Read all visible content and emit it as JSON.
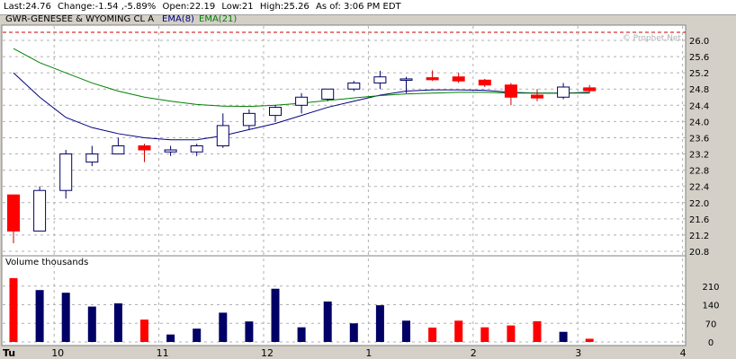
{
  "quote_bar": {
    "last": "Last:24.76",
    "change": "Change:-1.54 ,-5.89%",
    "open": "Open:22.19",
    "low": "Low:21",
    "high": "High:25.26",
    "as_of": "As of: 3:06 PM EDT"
  },
  "legend": {
    "symbol": "GWR-GENESEE & WYOMING CL A",
    "ema8": "EMA(8)",
    "ema21": "EMA(21)"
  },
  "watermark": "© Prophet.Net",
  "volume_label": "Volume  thousands",
  "colors": {
    "up_fill": "#ffffff",
    "down_fill": "#ff0000",
    "candle_outline": "#000066",
    "ema8": "#000080",
    "ema21": "#008000",
    "vol_up": "#000066",
    "vol_down": "#ff0000",
    "grid": "#b0b0b0",
    "high_line": "#cc0000"
  },
  "x_labels": [
    {
      "slot": 0,
      "text": "Tu",
      "bold": true
    },
    {
      "slot": 2,
      "text": "10"
    },
    {
      "slot": 6,
      "text": "11"
    },
    {
      "slot": 10,
      "text": "12"
    },
    {
      "slot": 14,
      "text": "1"
    },
    {
      "slot": 18,
      "text": "2"
    },
    {
      "slot": 22,
      "text": "3"
    },
    {
      "slot": 26,
      "text": "4"
    }
  ],
  "chart_data": [
    {
      "type": "candlestick",
      "title": "GWR-GENESEE & WYOMING CL A",
      "interval": "15-minute",
      "ylim": [
        20.8,
        26.0
      ],
      "yticks": [
        20.8,
        21.2,
        21.6,
        22.0,
        22.4,
        22.8,
        23.2,
        23.6,
        24.0,
        24.4,
        24.8,
        25.2,
        25.6,
        26.0
      ],
      "high_reference": 26.2,
      "candles": [
        {
          "o": 22.19,
          "h": 22.2,
          "l": 21.0,
          "c": 21.3
        },
        {
          "o": 21.3,
          "h": 22.4,
          "l": 21.3,
          "c": 22.3
        },
        {
          "o": 22.3,
          "h": 23.3,
          "l": 22.1,
          "c": 23.2
        },
        {
          "o": 23.0,
          "h": 23.4,
          "l": 22.9,
          "c": 23.2
        },
        {
          "o": 23.2,
          "h": 23.6,
          "l": 23.2,
          "c": 23.4
        },
        {
          "o": 23.4,
          "h": 23.45,
          "l": 23.0,
          "c": 23.3
        },
        {
          "o": 23.25,
          "h": 23.4,
          "l": 23.15,
          "c": 23.3
        },
        {
          "o": 23.25,
          "h": 23.45,
          "l": 23.15,
          "c": 23.4
        },
        {
          "o": 23.4,
          "h": 24.2,
          "l": 23.35,
          "c": 23.9
        },
        {
          "o": 23.9,
          "h": 24.3,
          "l": 23.8,
          "c": 24.2
        },
        {
          "o": 24.15,
          "h": 24.4,
          "l": 24.0,
          "c": 24.35
        },
        {
          "o": 24.4,
          "h": 24.7,
          "l": 24.2,
          "c": 24.6
        },
        {
          "o": 24.55,
          "h": 24.8,
          "l": 24.5,
          "c": 24.8
        },
        {
          "o": 24.8,
          "h": 25.0,
          "l": 24.75,
          "c": 24.95
        },
        {
          "o": 24.95,
          "h": 25.25,
          "l": 24.8,
          "c": 25.1
        },
        {
          "o": 25.05,
          "h": 25.1,
          "l": 24.7,
          "c": 25.05
        },
        {
          "o": 25.08,
          "h": 25.26,
          "l": 25.0,
          "c": 25.03
        },
        {
          "o": 25.1,
          "h": 25.2,
          "l": 24.95,
          "c": 25.0
        },
        {
          "o": 25.02,
          "h": 25.05,
          "l": 24.85,
          "c": 24.9
        },
        {
          "o": 24.9,
          "h": 24.95,
          "l": 24.4,
          "c": 24.6
        },
        {
          "o": 24.65,
          "h": 24.8,
          "l": 24.5,
          "c": 24.58
        },
        {
          "o": 24.6,
          "h": 24.95,
          "l": 24.55,
          "c": 24.85
        },
        {
          "o": 24.83,
          "h": 24.9,
          "l": 24.7,
          "c": 24.76
        }
      ],
      "series": [
        {
          "name": "EMA(8)",
          "values": [
            25.2,
            24.6,
            24.1,
            23.85,
            23.7,
            23.6,
            23.55,
            23.55,
            23.65,
            23.8,
            23.95,
            24.15,
            24.35,
            24.5,
            24.65,
            24.75,
            24.78,
            24.78,
            24.77,
            24.72,
            24.7,
            24.7,
            24.72
          ]
        },
        {
          "name": "EMA(21)",
          "values": [
            25.8,
            25.45,
            25.2,
            24.95,
            24.75,
            24.6,
            24.5,
            24.42,
            24.38,
            24.37,
            24.4,
            24.45,
            24.52,
            24.58,
            24.64,
            24.68,
            24.7,
            24.72,
            24.72,
            24.7,
            24.7,
            24.7,
            24.7
          ]
        }
      ]
    },
    {
      "type": "bar",
      "title": "Volume  thousands",
      "ylim": [
        0,
        280
      ],
      "yticks": [
        0,
        70,
        140,
        210
      ],
      "values": [
        240,
        195,
        185,
        133,
        145,
        84,
        28,
        50,
        110,
        77,
        200,
        55,
        152,
        70,
        138,
        80,
        54,
        80,
        55,
        62,
        78,
        38,
        12
      ],
      "direction": [
        "down",
        "up",
        "up",
        "up",
        "up",
        "down",
        "up",
        "up",
        "up",
        "up",
        "up",
        "up",
        "up",
        "up",
        "up",
        "up",
        "down",
        "down",
        "down",
        "down",
        "down",
        "up",
        "down"
      ]
    }
  ]
}
